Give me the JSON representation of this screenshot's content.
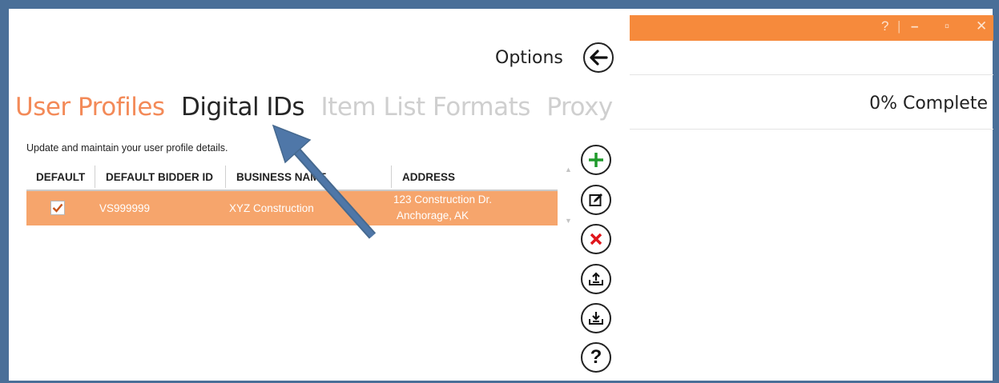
{
  "window": {
    "help_label": "?",
    "minimize_label": "–",
    "maximize_label": "▫",
    "close_label": "✕",
    "progress_text": "0% Complete",
    "accent_color": "#f68a3c"
  },
  "options": {
    "title": "Options",
    "back_icon": "arrow-left-icon",
    "tabs": [
      {
        "label": "User Profiles",
        "state": "active"
      },
      {
        "label": "Digital IDs",
        "state": "dark"
      },
      {
        "label": "Item List Formats",
        "state": "muted"
      },
      {
        "label": "Proxy",
        "state": "muted"
      }
    ],
    "description": "Update and maintain your user profile details."
  },
  "grid": {
    "columns": [
      "DEFAULT",
      "DEFAULT BIDDER ID",
      "BUSINESS NAME",
      "ADDRESS"
    ],
    "rows": [
      {
        "default_checked": true,
        "bidder_id": "VS999999",
        "business_name": "XYZ Construction",
        "address_line1": "123 Construction Dr.",
        "address_line2": "Anchorage, AK"
      }
    ],
    "selected_row_color": "#f6a56c"
  },
  "actions": [
    {
      "name": "add-button",
      "icon": "plus-icon"
    },
    {
      "name": "edit-button",
      "icon": "edit-icon"
    },
    {
      "name": "delete-button",
      "icon": "close-icon"
    },
    {
      "name": "export-button",
      "icon": "upload-icon"
    },
    {
      "name": "import-button",
      "icon": "download-icon"
    },
    {
      "name": "help-button",
      "icon": "question-icon"
    }
  ]
}
